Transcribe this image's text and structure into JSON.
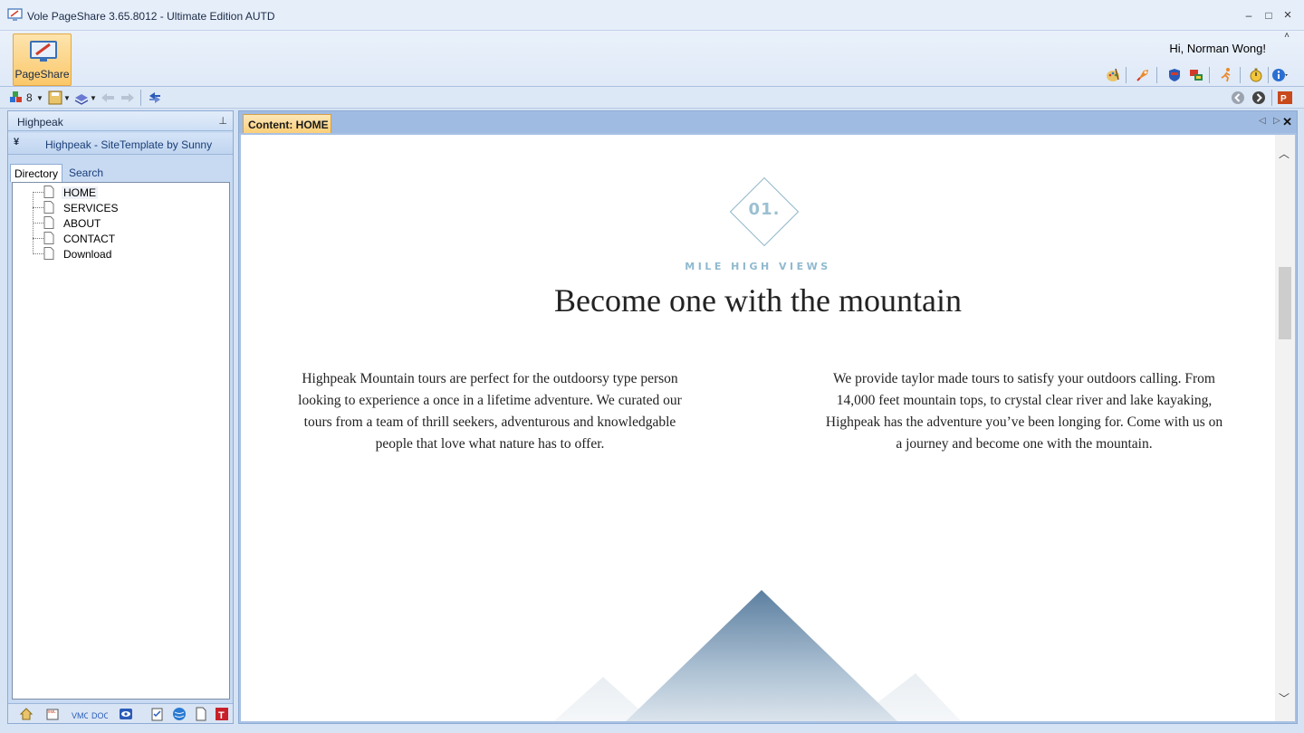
{
  "window": {
    "title": "Vole PageShare  3.65.8012 - Ultimate Edition AUTD",
    "minimize": "–",
    "maximize": "□",
    "close": "×"
  },
  "ribbon": {
    "pageshare_label": "PageShare",
    "greeting": "Hi, Norman Wong!",
    "collapse": "˄"
  },
  "toolbar": {
    "count": "8"
  },
  "left_panel": {
    "title": "Highpeak",
    "pin": "⊥",
    "template": "Highpeak - SiteTemplate by Sunny",
    "tabs": [
      "Directory",
      "Search"
    ],
    "tree": [
      "HOME",
      "SERVICES",
      "ABOUT",
      "CONTACT",
      "Download"
    ]
  },
  "content": {
    "tab_label": "Content: HOME",
    "close": "✕",
    "page": {
      "number": "01.",
      "eyebrow": "MILE HIGH VIEWS",
      "headline": "Become one with the mountain",
      "paragraph_left": "Highpeak Mountain tours are perfect for the outdoorsy type person looking to experience a once in a lifetime adventure. We curated our tours from a team of thrill seekers, adventurous and knowledgable people that love what nature has to offer.",
      "paragraph_right": "We provide taylor made tours to satisfy your outdoors calling. From 14,000 feet mountain tops, to crystal clear river and lake kayaking, Highpeak has the adventure you’ve been longing for. Come with us on a journey and become one with the mountain."
    }
  },
  "colors": {
    "accent_orange": "#fbcf79",
    "frame_blue": "#a9c2e4",
    "eyebrow_blue": "#8fb9cf"
  }
}
